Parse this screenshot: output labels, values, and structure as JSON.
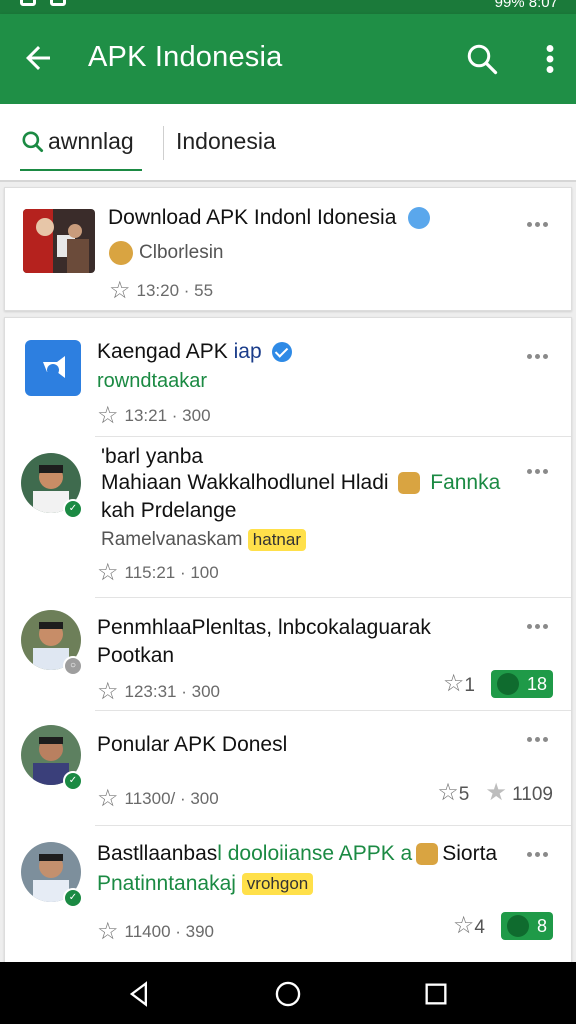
{
  "appbar": {
    "title": "APK Indonesia"
  },
  "search": {
    "tab_label": "awnnlag",
    "field_value": "Indonesia"
  },
  "feed": {
    "card1": {
      "title": "Download APK Indonl Idonesia",
      "subtitle": "Clborlesin",
      "meta": "13:20 · 55"
    },
    "items": [
      {
        "title": "Kaengad APK",
        "title_accent": "iap",
        "subtitle": "rowndtaakar",
        "meta": "13:21 · 300"
      },
      {
        "line1": "'barl yanba",
        "line2a": "Mahiaan Wakkalhodlunel Hladi",
        "line2b": "Fannka",
        "line3": "kah Prdelange",
        "line4": "Ramelvanaskam",
        "tag": "hatnar",
        "meta": "115:21 · 100"
      },
      {
        "line1": "PenmhlaaPlenltas, lnbcokalaguarak",
        "line2": "Pootkan",
        "meta": "123:31 · 300",
        "stat_star": "1",
        "pill": "18"
      },
      {
        "title": "Ponular APK Donesl",
        "meta": "11300/ · 300",
        "stat_star": "5",
        "stat_filled": "1109"
      },
      {
        "line1a": "Bastllaanbas",
        "line1b": "l doolo",
        "line1c": "iianse APPK a",
        "line1d": "Siorta",
        "line2": "Pnatinntanakaj",
        "tag": "vrohgon",
        "meta": "11400 · 390",
        "stat_star": "4",
        "pill": "8"
      }
    ]
  },
  "status": {
    "right_text": "99% 8:07"
  },
  "colors": {
    "primary": "#1f8f46",
    "accent": "#1b8a43",
    "verified": "#2e8ae6",
    "tag": "#ffe04a"
  }
}
